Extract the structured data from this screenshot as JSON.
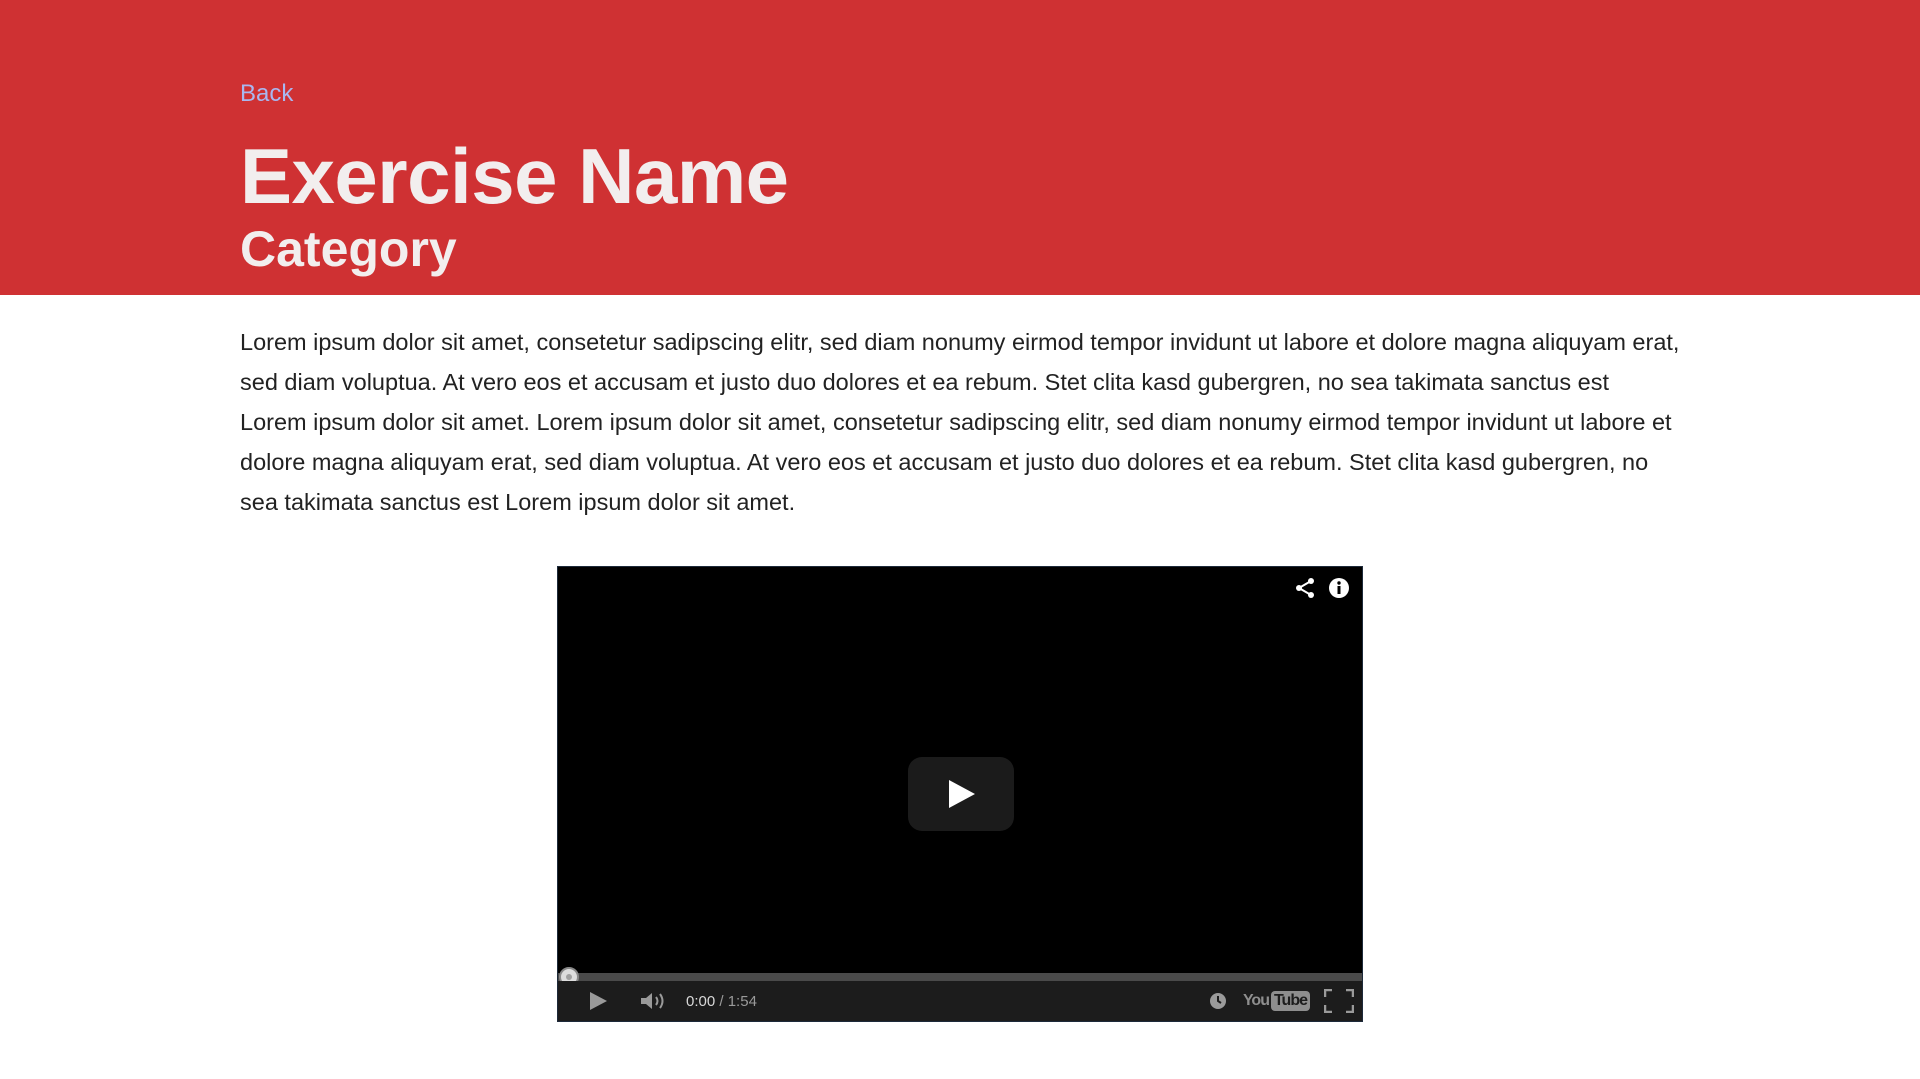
{
  "header": {
    "back_label": "Back",
    "title": "Exercise Name",
    "category": "Category",
    "background_color": "#cf3133"
  },
  "description": "Lorem ipsum dolor sit amet, consetetur sadipscing elitr, sed diam nonumy eirmod tempor invidunt ut labore et dolore magna aliquyam erat, sed diam voluptua. At vero eos et accusam et justo duo dolores et ea rebum. Stet clita kasd gubergren, no sea takimata sanctus est Lorem ipsum dolor sit amet. Lorem ipsum dolor sit amet, consetetur sadipscing elitr, sed diam nonumy eirmod tempor invidunt ut labore et dolore magna aliquyam erat, sed diam voluptua. At vero eos et accusam et justo duo dolores et ea rebum. Stet clita kasd gubergren, no sea takimata sanctus est Lorem ipsum dolor sit amet.",
  "video": {
    "current_time": "0:00",
    "separator": " / ",
    "duration": "1:54",
    "progress": 0,
    "logo_you": "You",
    "logo_tube": "Tube",
    "icons": [
      "share-icon",
      "info-icon",
      "play-icon",
      "volume-icon",
      "watch-later-icon",
      "youtube-logo",
      "fullscreen-icon"
    ]
  }
}
